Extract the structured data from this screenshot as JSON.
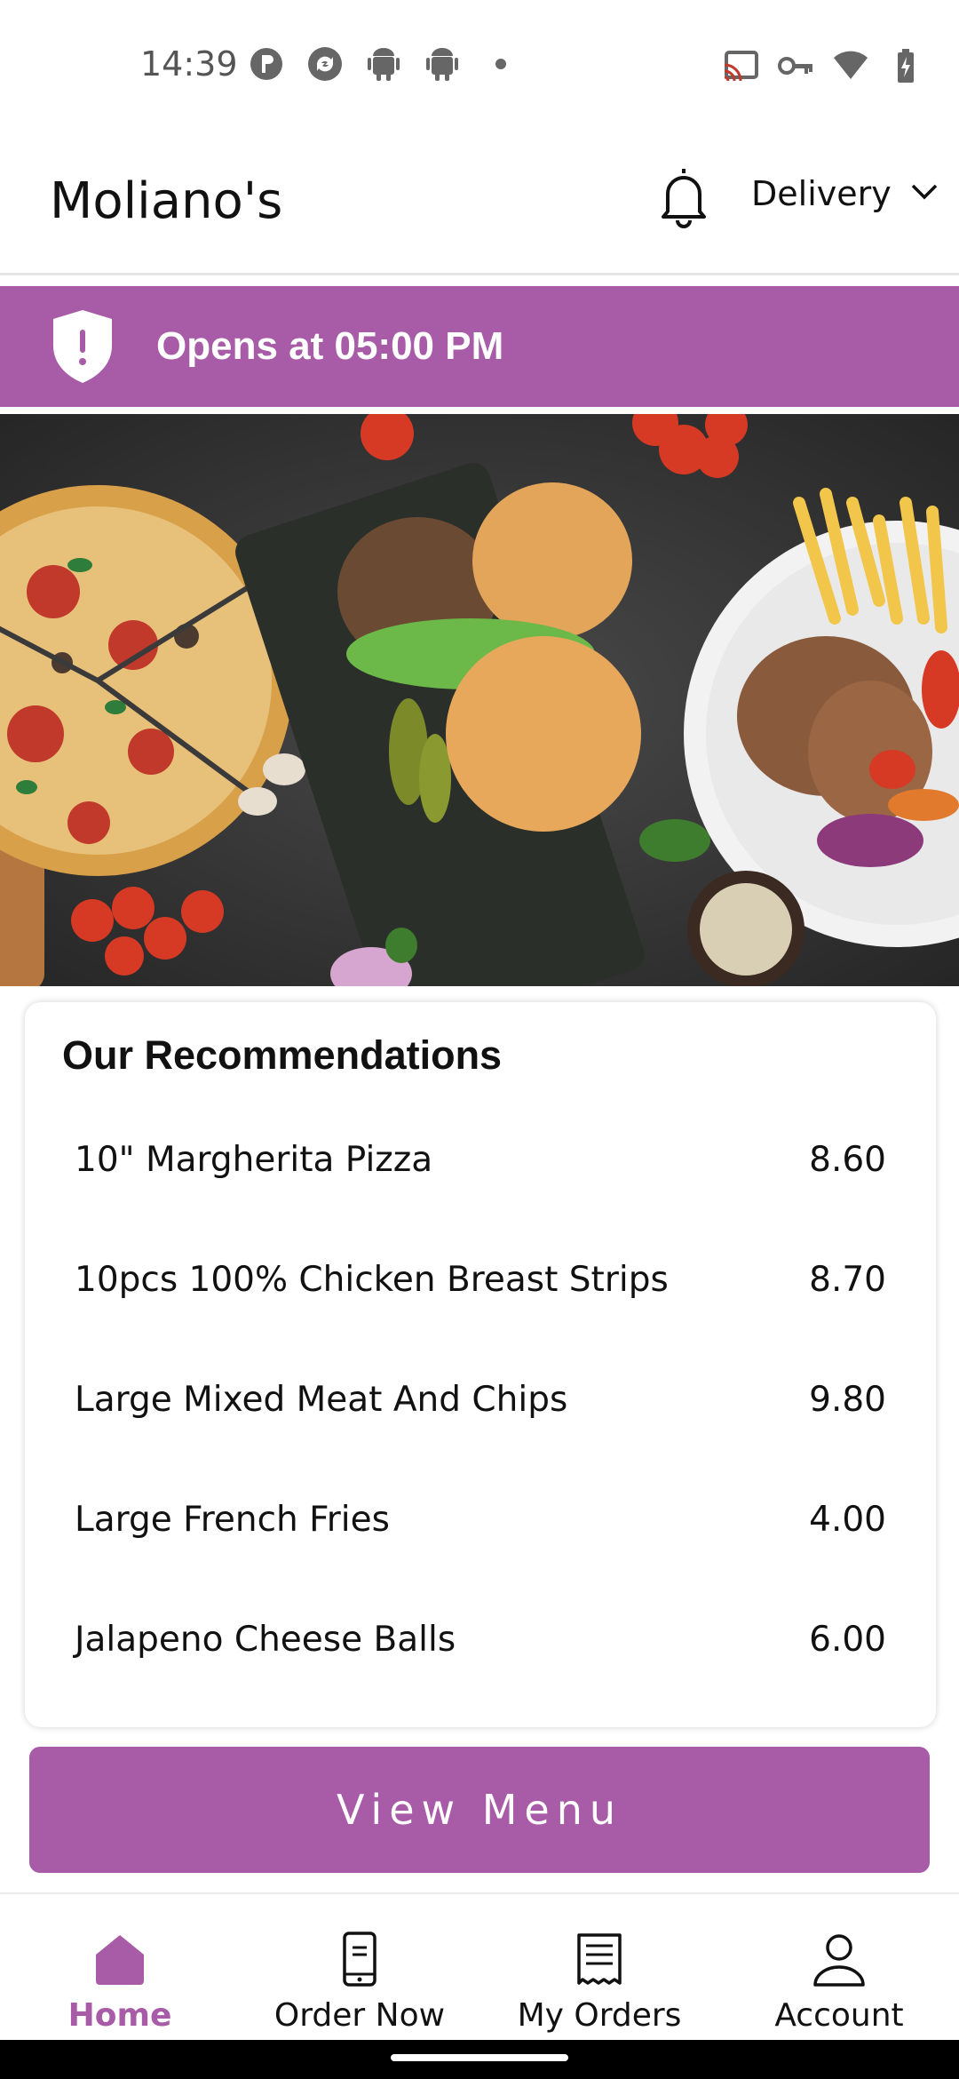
{
  "status_bar": {
    "time": "14:39",
    "left_icons": [
      "pinterest-style-icon",
      "sync-icon",
      "android-icon",
      "android-icon",
      "dot-icon"
    ],
    "right_icons": [
      "cast-icon",
      "vpn-key-icon",
      "wifi-icon",
      "battery-charging-icon"
    ]
  },
  "header": {
    "brand": "Moliano's",
    "notification_icon": "bell-icon",
    "order_mode": "Delivery",
    "order_mode_icon": "chevron-down-icon"
  },
  "banner": {
    "icon": "shield-alert-icon",
    "text": "Opens at 05:00 PM",
    "color": "#a85ba6"
  },
  "hero": {
    "image": "food-collage-image"
  },
  "recommendations": {
    "title": "Our Recommendations",
    "items": [
      {
        "name": "10\" Margherita Pizza",
        "price": "8.60"
      },
      {
        "name": "10pcs 100% Chicken Breast Strips",
        "price": "8.70"
      },
      {
        "name": "Large Mixed Meat And Chips",
        "price": "9.80"
      },
      {
        "name": "Large French Fries",
        "price": "4.00"
      },
      {
        "name": "Jalapeno Cheese Balls",
        "price": "6.00"
      }
    ]
  },
  "cta": {
    "label": "View Menu",
    "color": "#a85ba6"
  },
  "bottom_nav": {
    "items": [
      {
        "label": "Home",
        "icon": "home-icon",
        "active": true
      },
      {
        "label": "Order Now",
        "icon": "phone-order-icon",
        "active": false
      },
      {
        "label": "My Orders",
        "icon": "receipt-icon",
        "active": false
      },
      {
        "label": "Account",
        "icon": "person-icon",
        "active": false
      }
    ],
    "active_color": "#a85ba6"
  }
}
